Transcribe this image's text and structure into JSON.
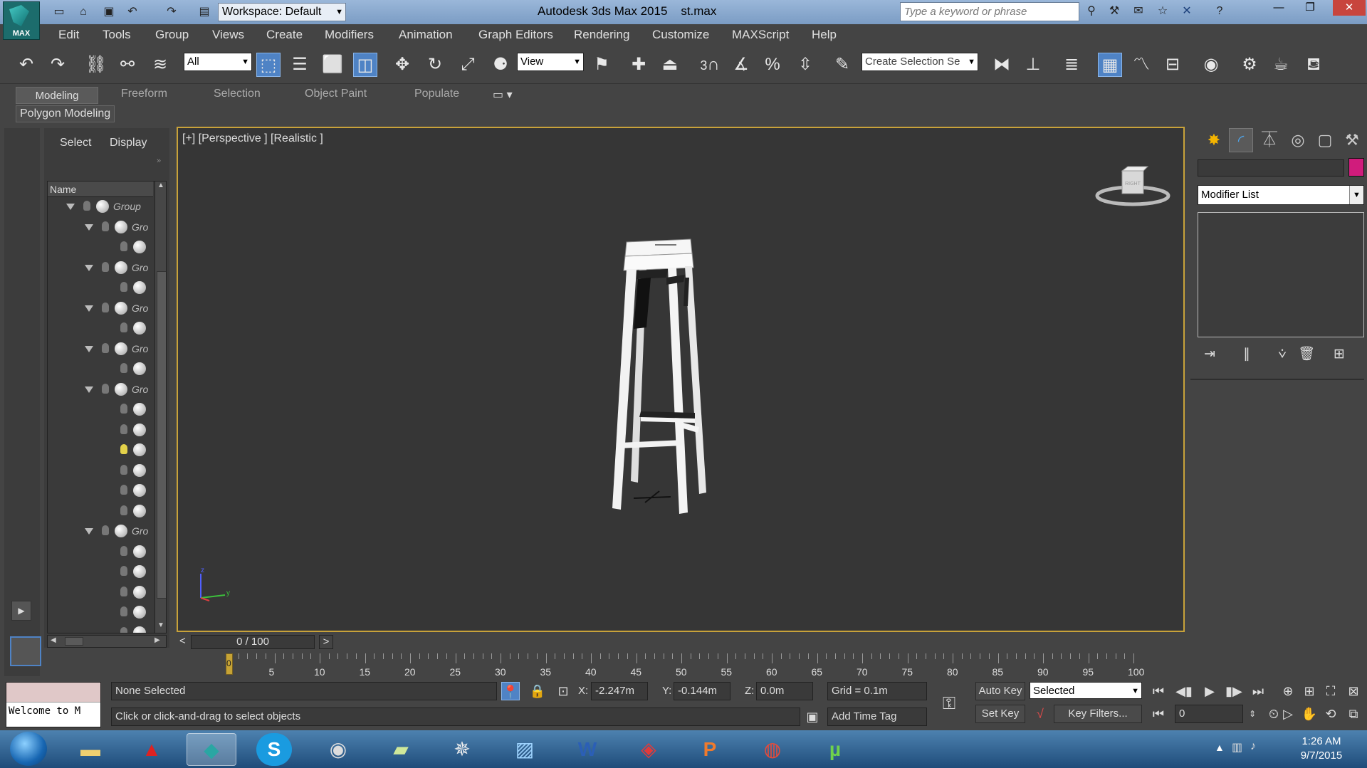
{
  "titlebar": {
    "app_logo_text": "MAX",
    "workspace": "Workspace: Default",
    "title_app": "Autodesk 3ds Max  2015",
    "title_file": "st.max",
    "search_placeholder": "Type a keyword or phrase"
  },
  "menu": [
    "Edit",
    "Tools",
    "Group",
    "Views",
    "Create",
    "Modifiers",
    "Animation",
    "Graph Editors",
    "Rendering",
    "Customize",
    "MAXScript",
    "Help"
  ],
  "toolbar": {
    "selection_filter": "All",
    "ref_coord": "View",
    "snap_label": "3",
    "selection_set_placeholder": "Create Selection Se"
  },
  "ribbon": {
    "tabs": [
      "Modeling",
      "Freeform",
      "Selection",
      "Object Paint",
      "Populate"
    ],
    "active_panel": "Polygon Modeling"
  },
  "explorer": {
    "tabs": [
      "Select",
      "Display"
    ],
    "column_header": "Name",
    "items": [
      {
        "label": "Group",
        "level": 0,
        "expanded": true
      },
      {
        "label": "Gro",
        "level": 1,
        "expanded": true
      },
      {
        "label": "",
        "level": 2
      },
      {
        "label": "Gro",
        "level": 1,
        "expanded": true
      },
      {
        "label": "",
        "level": 2
      },
      {
        "label": "Gro",
        "level": 1,
        "expanded": true
      },
      {
        "label": "",
        "level": 2
      },
      {
        "label": "Gro",
        "level": 1,
        "expanded": true
      },
      {
        "label": "",
        "level": 2
      },
      {
        "label": "Gro",
        "level": 1,
        "expanded": true
      },
      {
        "label": "",
        "level": 2
      },
      {
        "label": "",
        "level": 2
      },
      {
        "label": "",
        "level": 2,
        "light_on": true
      },
      {
        "label": "",
        "level": 2
      },
      {
        "label": "",
        "level": 2
      },
      {
        "label": "",
        "level": 2
      },
      {
        "label": "Gro",
        "level": 1,
        "expanded": true
      },
      {
        "label": "",
        "level": 2
      },
      {
        "label": "",
        "level": 2
      },
      {
        "label": "",
        "level": 2
      },
      {
        "label": "",
        "level": 2
      },
      {
        "label": "",
        "level": 2
      }
    ]
  },
  "viewport": {
    "label": "[+] [Perspective ] [Realistic ]",
    "viewcube_face": "RIGHT",
    "axis_labels": [
      "z",
      "y"
    ],
    "border_color": "#c8a23a"
  },
  "command_panel": {
    "modifier_list": "Modifier List",
    "color_swatch": "#d01c7c"
  },
  "timeline": {
    "slider_text": "0 / 100",
    "prev_btn": "<",
    "next_btn": ">",
    "current_frame": 0,
    "ticks": [
      "0",
      "5",
      "10",
      "15",
      "20",
      "25",
      "30",
      "35",
      "40",
      "45",
      "50",
      "55",
      "60",
      "65",
      "70",
      "75",
      "80",
      "85",
      "90",
      "95",
      "100"
    ]
  },
  "status": {
    "listener_text": "Welcome to M",
    "selection": "None Selected",
    "prompt": "Click or click-and-drag to select objects",
    "x_label": "X:",
    "x_value": "-2.247m",
    "y_label": "Y:",
    "y_value": "-0.144m",
    "z_label": "Z:",
    "z_value": "0.0m",
    "grid": "Grid = 0.1m",
    "add_time_tag": "Add Time Tag",
    "auto_key": "Auto Key",
    "set_key": "Set Key",
    "key_mode": "Selected",
    "key_filters": "Key Filters...",
    "frame_field": "0"
  },
  "taskbar": {
    "apps": [
      "explorer",
      "autocad",
      "3dsmax",
      "skype",
      "cinema4d",
      "sticky-notes",
      "pose-app",
      "photos",
      "word",
      "sketchup",
      "powerpoint",
      "chrome",
      "utorrent"
    ],
    "time": "1:26 AM",
    "date": "9/7/2015"
  }
}
